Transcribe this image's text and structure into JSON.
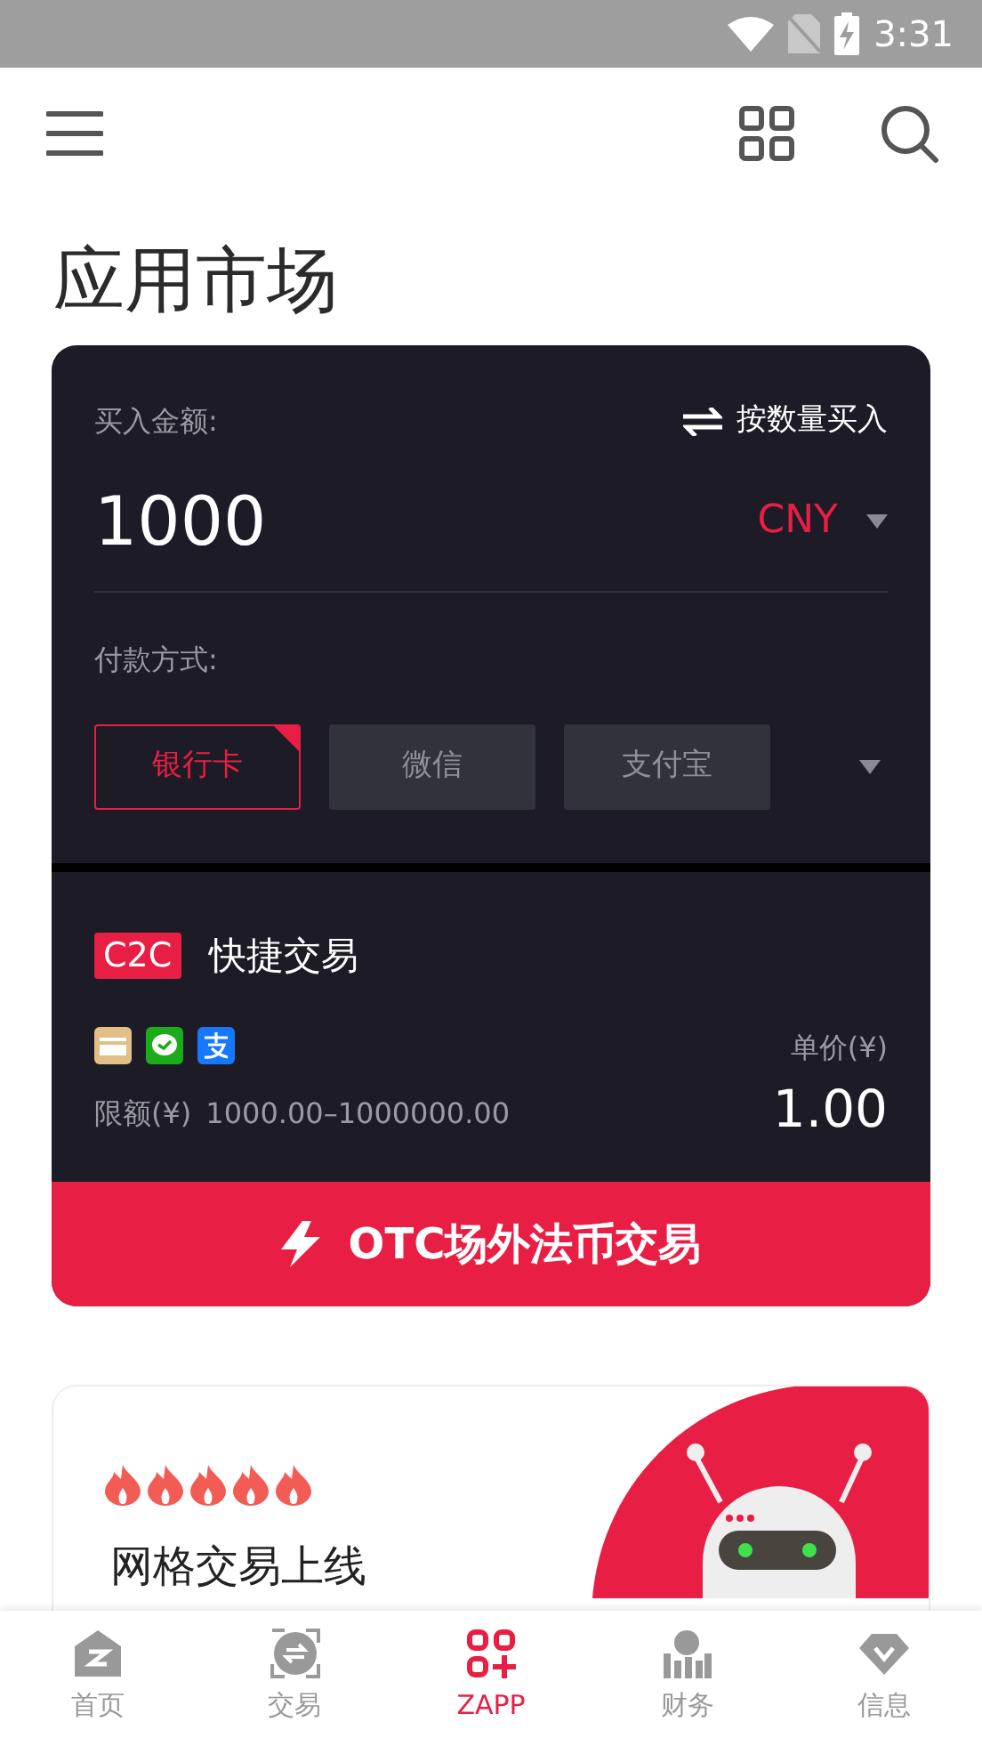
{
  "status_bar": {
    "time": "3:31"
  },
  "page_title": "应用市场",
  "buy_card": {
    "amount_label": "买入金额:",
    "switch_mode": "按数量买入",
    "amount": "1000",
    "currency": "CNY",
    "payment_label": "付款方式:",
    "payment_methods": [
      {
        "label": "银行卡",
        "selected": true
      },
      {
        "label": "微信",
        "selected": false
      },
      {
        "label": "支付宝",
        "selected": false
      }
    ]
  },
  "c2c": {
    "badge": "C2C",
    "title": "快捷交易",
    "limit_label": "限额(¥)",
    "limit": "1000.00–1000000.00",
    "price_label": "单价(¥)",
    "price": "1.00"
  },
  "otc_button": "OTC场外法币交易",
  "promo": {
    "stars": 5,
    "title": "网格交易上线"
  },
  "bottom_nav": [
    {
      "label": "首页",
      "selected": false,
      "kind": "home"
    },
    {
      "label": "交易",
      "selected": false,
      "kind": "trade"
    },
    {
      "label": "ZAPP",
      "selected": true,
      "kind": "apps"
    },
    {
      "label": "财务",
      "selected": false,
      "kind": "finance"
    },
    {
      "label": "信息",
      "selected": false,
      "kind": "info"
    }
  ]
}
